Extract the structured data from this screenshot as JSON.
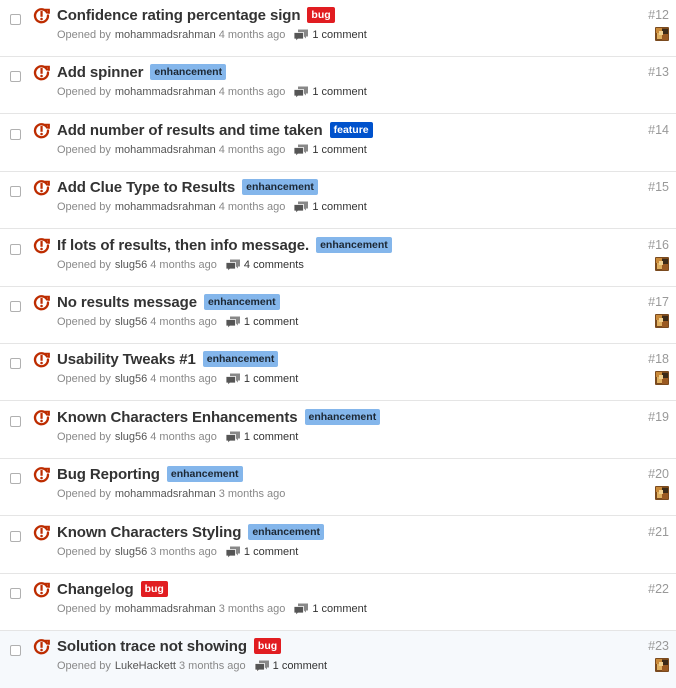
{
  "meta_prefix": "Opened by",
  "colors": {
    "bug": "#e11d21",
    "enhancement": "#84b6eb",
    "feature": "#0052cc",
    "open_icon": "#bd2c00"
  },
  "issues": [
    {
      "title": "Confidence rating percentage sign",
      "label": "bug",
      "label_type": "bug",
      "author": "mohammadsrahman",
      "time": "4 months ago",
      "comments": "1 comment",
      "number": "#12",
      "avatar": true
    },
    {
      "title": "Add spinner",
      "label": "enhancement",
      "label_type": "enhancement",
      "author": "mohammadsrahman",
      "time": "4 months ago",
      "comments": "1 comment",
      "number": "#13",
      "avatar": false
    },
    {
      "title": "Add number of results and time taken",
      "label": "feature",
      "label_type": "feature",
      "author": "mohammadsrahman",
      "time": "4 months ago",
      "comments": "1 comment",
      "number": "#14",
      "avatar": false
    },
    {
      "title": "Add Clue Type to Results",
      "label": "enhancement",
      "label_type": "enhancement",
      "author": "mohammadsrahman",
      "time": "4 months ago",
      "comments": "1 comment",
      "number": "#15",
      "avatar": false
    },
    {
      "title": "If lots of results, then info message.",
      "label": "enhancement",
      "label_type": "enhancement",
      "author": "slug56",
      "time": "4 months ago",
      "comments": "4 comments",
      "number": "#16",
      "avatar": true
    },
    {
      "title": "No results message",
      "label": "enhancement",
      "label_type": "enhancement",
      "author": "slug56",
      "time": "4 months ago",
      "comments": "1 comment",
      "number": "#17",
      "avatar": true
    },
    {
      "title": "Usability Tweaks #1",
      "label": "enhancement",
      "label_type": "enhancement",
      "author": "slug56",
      "time": "4 months ago",
      "comments": "1 comment",
      "number": "#18",
      "avatar": true
    },
    {
      "title": "Known Characters Enhancements",
      "label": "enhancement",
      "label_type": "enhancement",
      "author": "slug56",
      "time": "4 months ago",
      "comments": "1 comment",
      "number": "#19",
      "avatar": false
    },
    {
      "title": "Bug Reporting",
      "label": "enhancement",
      "label_type": "enhancement",
      "author": "mohammadsrahman",
      "time": "3 months ago",
      "comments": "",
      "number": "#20",
      "avatar": true
    },
    {
      "title": "Known Characters Styling",
      "label": "enhancement",
      "label_type": "enhancement",
      "author": "slug56",
      "time": "3 months ago",
      "comments": "1 comment",
      "number": "#21",
      "avatar": false
    },
    {
      "title": "Changelog",
      "label": "bug",
      "label_type": "bug",
      "author": "mohammadsrahman",
      "time": "3 months ago",
      "comments": "1 comment",
      "number": "#22",
      "avatar": false
    },
    {
      "title": "Solution trace not showing",
      "label": "bug",
      "label_type": "bug",
      "author": "LukeHackett",
      "time": "3 months ago",
      "comments": "1 comment",
      "number": "#23",
      "avatar": true
    }
  ]
}
